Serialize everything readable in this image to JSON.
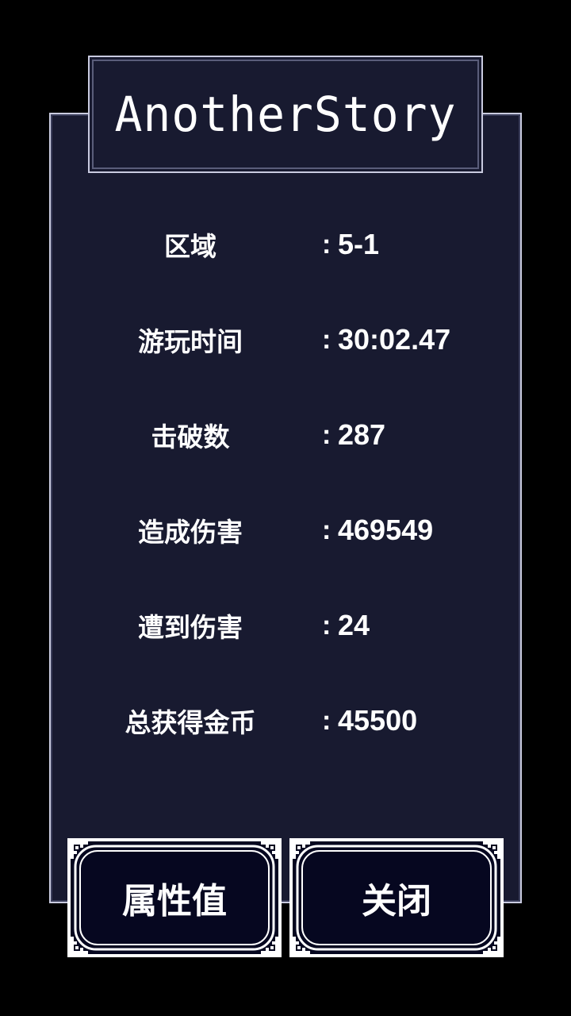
{
  "title": "AnotherStory",
  "stats": [
    {
      "label": "区域",
      "colon": ":",
      "value": "5-1"
    },
    {
      "label": "游玩时间",
      "colon": ":",
      "value": "30:02.47"
    },
    {
      "label": "击破数",
      "colon": ":",
      "value": "287"
    },
    {
      "label": "造成伤害",
      "colon": ":",
      "value": "469549"
    },
    {
      "label": "遭到伤害",
      "colon": ":",
      "value": "24"
    },
    {
      "label": "总获得金币",
      "colon": ":",
      "value": "45500"
    }
  ],
  "buttons": {
    "attributes_label": "属性值",
    "close_label": "关闭"
  },
  "colors": {
    "panel_bg": "#181a30",
    "button_bg": "#060720",
    "border": "#c9cbe0",
    "text": "#ffffff"
  }
}
